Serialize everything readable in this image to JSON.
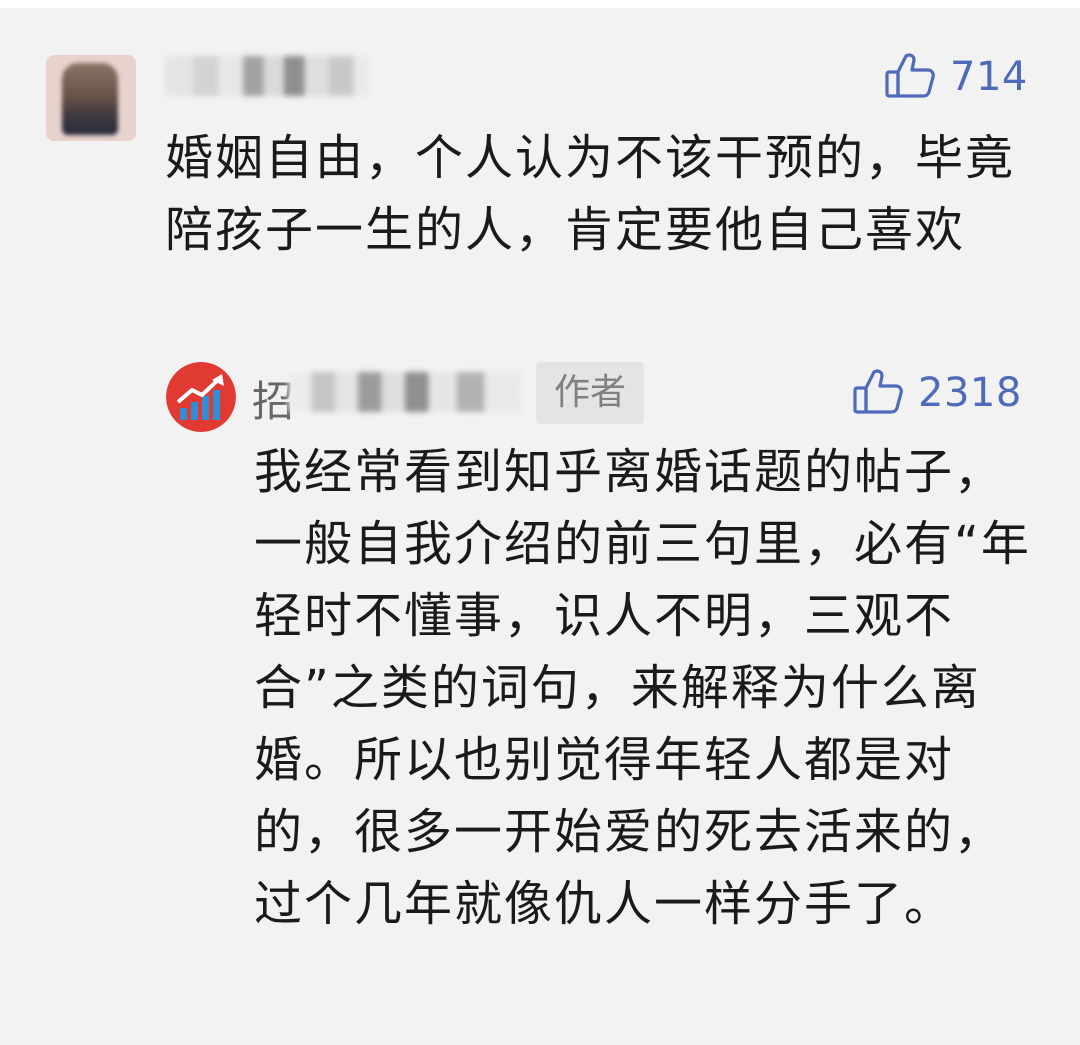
{
  "comment": {
    "likes": "714",
    "text": "婚姻自由，个人认为不该干预的，毕竟陪孩子一生的人，肯定要他自己喜欢"
  },
  "reply": {
    "author_initial": "招",
    "author_badge": "作者",
    "likes": "2318",
    "text": "我经常看到知乎离婚话题的帖子，一般自我介绍的前三句里，必有“年轻时不懂事，识人不明，三观不合”之类的词句，来解释为什么离婚。所以也别觉得年轻人都是对的，很多一开始爱的死去活来的，过个几年就像仇人一样分手了。"
  },
  "icons": {
    "like": "thumbs-up-icon",
    "author_avatar": "rising-chart-icon"
  },
  "colors": {
    "like_accent": "#4e6ab8",
    "background": "#f2f2f2",
    "author_avatar_red": "#e03a33",
    "author_avatar_blue": "#2f8fd6"
  }
}
